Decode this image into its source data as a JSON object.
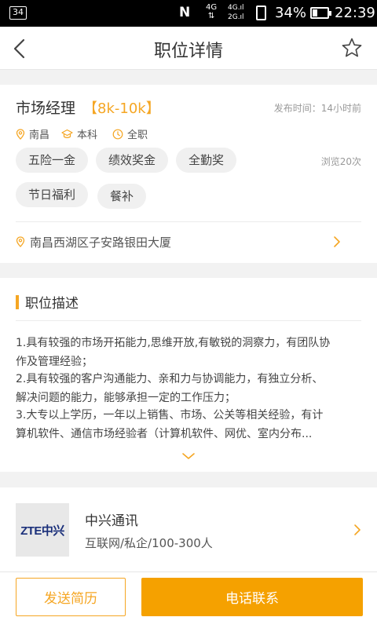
{
  "status_bar": {
    "notification_count": "34",
    "nfc": "N",
    "network_4g": "4G",
    "signal_1": "4G.ıl",
    "signal_2": "2G.ıl",
    "battery_percent": "34%",
    "battery_level": 0.34,
    "time": "22:39"
  },
  "header": {
    "title": "职位详情",
    "back_icon": "chevron-left-icon",
    "favorite_icon": "star-outline-icon"
  },
  "job": {
    "title": "市场经理",
    "salary": "【8k-10k】",
    "post_time": "发布时间：14小时前",
    "location": "南昌",
    "education": "本科",
    "job_type": "全职",
    "benefits": [
      "五险一金",
      "绩效奖金",
      "全勤奖",
      "节日福利",
      "餐补"
    ],
    "views": "浏览20次",
    "address": "南昌西湖区子安路银田大厦"
  },
  "description": {
    "heading": "职位描述",
    "lines": [
      "1.具有较强的市场开拓能力,思维开放,有敏锐的洞察力，有团队协",
      "作及管理经验；",
      " 2.具有较强的客户沟通能力、亲和力与协调能力，有独立分析、",
      "解决问题的能力，能够承担一定的工作压力；",
      " 3.大专以上学历，一年以上销售、市场、公关等相关经验，有计",
      "算机软件、通信市场经验者（计算机软件、网优、室内分布..."
    ]
  },
  "company": {
    "logo_text": "ZTE中兴",
    "name": "中兴通讯",
    "info": "互联网/私企/100-300人"
  },
  "actions": {
    "send_resume": "发送简历",
    "call": "电话联系"
  },
  "colors": {
    "accent": "#f5a623",
    "primary_button": "#f5a100",
    "logo_text": "#1a2f7a"
  }
}
